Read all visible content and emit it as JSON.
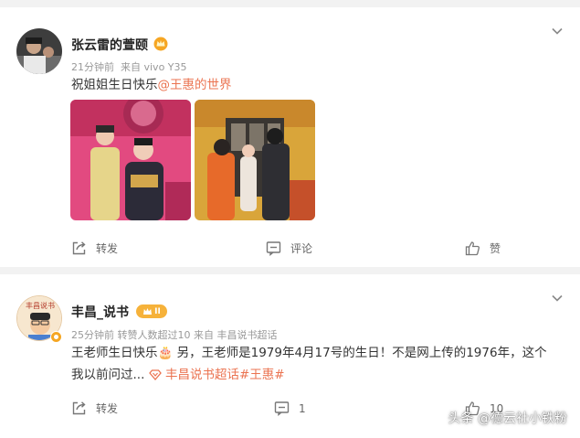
{
  "posts": [
    {
      "username": "张云雷的萱颐",
      "time": "21分钟前",
      "source": "来自 vivo Y35",
      "text_prefix": "祝姐姐生日快乐",
      "mention": "@王惠的世界",
      "actions": {
        "repost": "转发",
        "comment": "评论",
        "like": "赞"
      }
    },
    {
      "username": "丰昌_说书",
      "level_badge": "II",
      "avatar_text": "丰昌说书",
      "meta": "25分钟前 转赞人数超过10 来自 丰昌说书超话",
      "text_line1": "王老师生日快乐🎂 另，王老师是1979年4月17号的生日！不是网上传的1976年，这个",
      "text_line2_prefix": "我以前问过...",
      "tag": "丰昌说书超话#王惠#",
      "actions": {
        "repost": "转发",
        "comment": "1",
        "like": "10"
      }
    }
  ],
  "watermark": "头条 @德云社小铁粉",
  "colors": {
    "accent": "#eb7350",
    "meta": "#999999"
  }
}
